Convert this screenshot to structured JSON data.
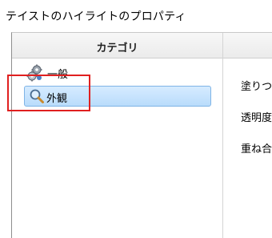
{
  "window": {
    "title": "テイストのハイライトのプロパティ"
  },
  "category_panel": {
    "header": "カテゴリ",
    "items": [
      {
        "label": "一般",
        "icon": "gears-icon",
        "selected": false
      },
      {
        "label": "外観",
        "icon": "magnifier-icon",
        "selected": true
      }
    ]
  },
  "properties": {
    "labels": [
      "塗りつぶ",
      "透明度",
      "重ね合"
    ]
  },
  "colors": {
    "selection_bg": "#c4e2fd",
    "selection_border": "#7fb4e6",
    "annotation_box": "#e02020"
  }
}
